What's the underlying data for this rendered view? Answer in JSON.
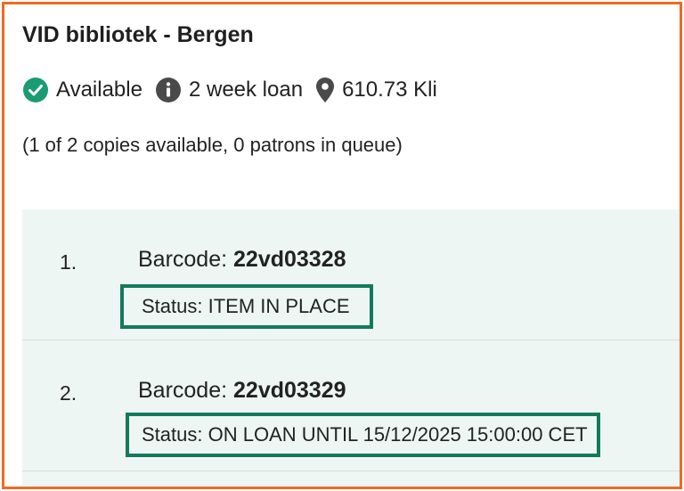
{
  "location": {
    "title": "VID bibliotek - Bergen"
  },
  "info": {
    "availability": "Available",
    "loan_policy": "2 week loan",
    "call_number": "610.73 Kli"
  },
  "summary": "(1 of 2 copies available, 0 patrons in queue)",
  "items": [
    {
      "number": "1.",
      "barcode_label": "Barcode: ",
      "barcode": "22vd03328",
      "status": "Status: ITEM IN PLACE"
    },
    {
      "number": "2.",
      "barcode_label": "Barcode: ",
      "barcode": "22vd03329",
      "status": "Status: ON LOAN UNTIL 15/12/2025 15:00:00 CET"
    }
  ],
  "icons": {
    "availability": "check-circle-icon",
    "loan_policy": "info-circle-icon",
    "call_number": "map-pin-icon"
  },
  "colors": {
    "frame_border": "#f06a23",
    "available_green": "#1a9c72",
    "status_border": "#127a5b",
    "items_background": "#eef6f4"
  }
}
